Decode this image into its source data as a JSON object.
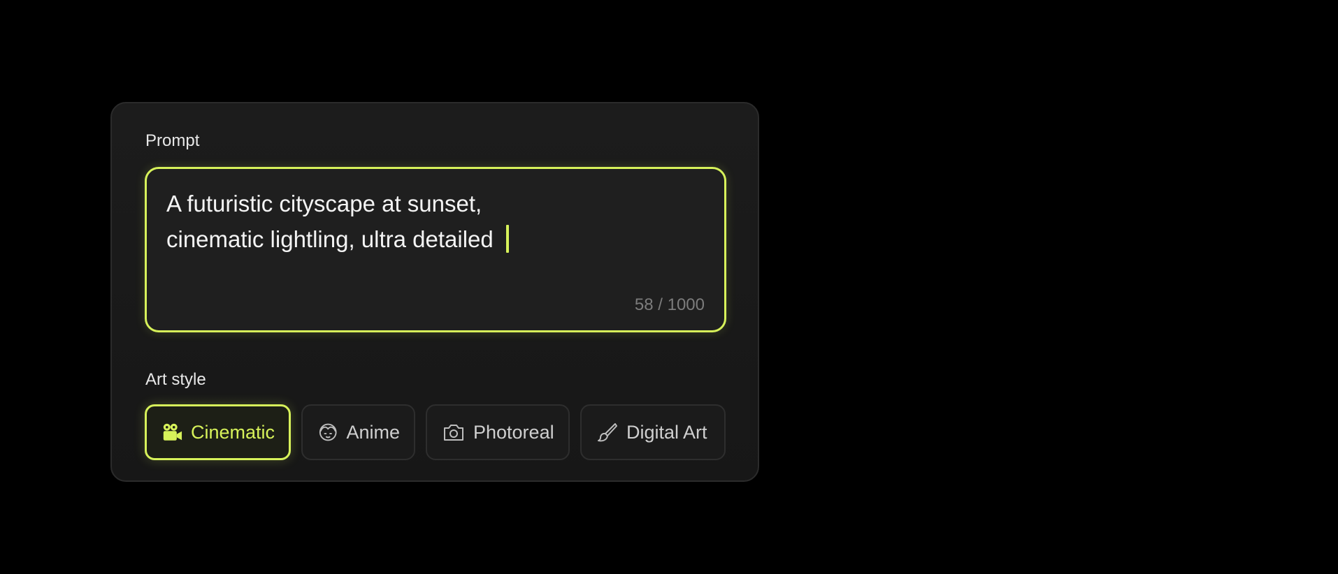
{
  "prompt": {
    "label": "Prompt",
    "value": "A futuristic cityscape at sunset,\ncinematic lightling, ultra detailed",
    "char_count": "58 / 1000"
  },
  "art_style": {
    "label": "Art style",
    "options": [
      {
        "label": "Cinematic",
        "icon": "video-camera-icon",
        "selected": true
      },
      {
        "label": "Anime",
        "icon": "anime-face-icon",
        "selected": false
      },
      {
        "label": "Photoreal",
        "icon": "camera-icon",
        "selected": false
      },
      {
        "label": "Digital Art",
        "icon": "brush-icon",
        "selected": false
      }
    ]
  },
  "colors": {
    "accent": "#d7f25a",
    "background": "#000000",
    "card": "#1a1a1a"
  }
}
